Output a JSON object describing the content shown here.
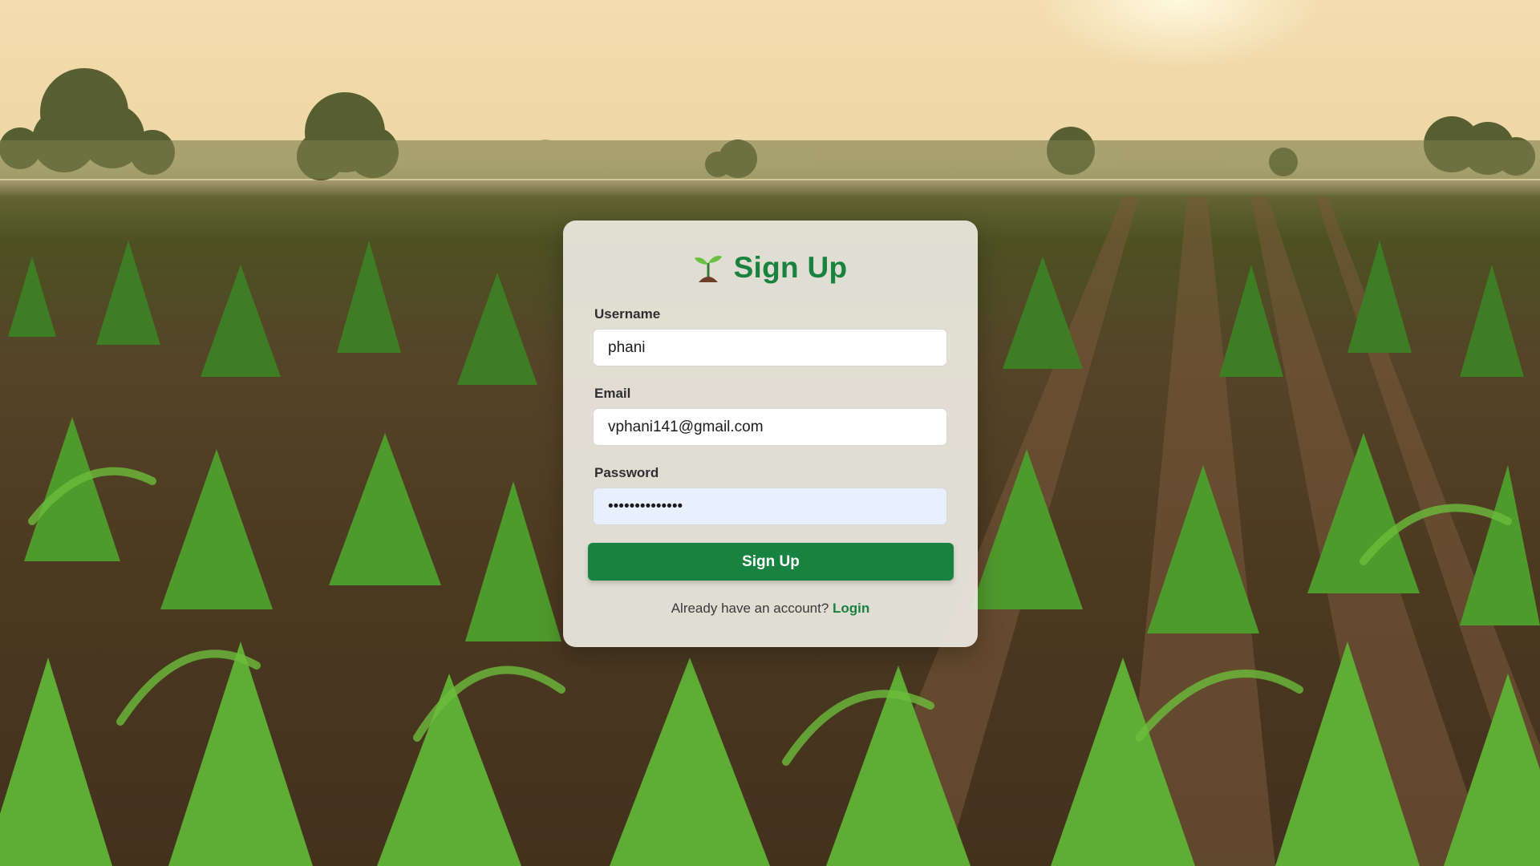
{
  "form": {
    "title": "Sign Up",
    "title_icon": "seedling-icon",
    "username_label": "Username",
    "username_value": "phani",
    "email_label": "Email",
    "email_value": "vphani141@gmail.com",
    "password_label": "Password",
    "password_value": "••••••••••••••",
    "submit_label": "Sign Up",
    "footer_text": "Already have an account?",
    "footer_link": "Login"
  },
  "colors": {
    "accent": "#188340",
    "card_background": "#ecebe0",
    "autofill_background": "#e8f0fe"
  }
}
